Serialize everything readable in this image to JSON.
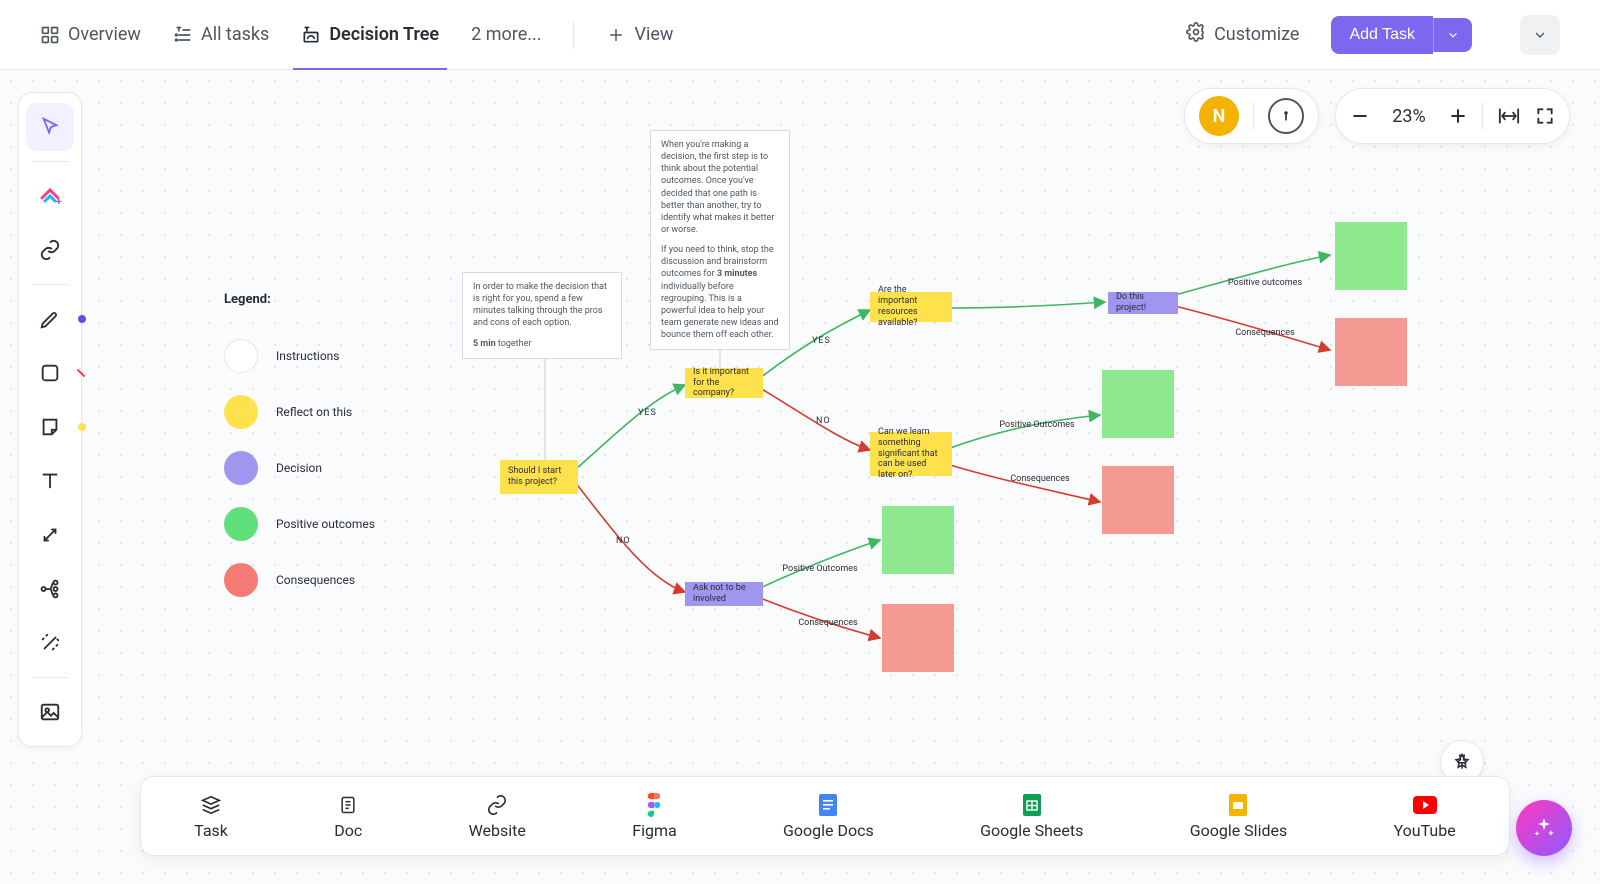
{
  "tabs": {
    "overview": "Overview",
    "all_tasks": "All tasks",
    "decision_tree": "Decision Tree",
    "more": "2 more...",
    "view": "View"
  },
  "top_actions": {
    "customize": "Customize",
    "add_task": "Add Task"
  },
  "avatar_initial": "N",
  "zoom_label": "23%",
  "legend": {
    "title": "Legend:",
    "items": [
      {
        "label": "Instructions",
        "color": "#ffffff",
        "border": "#e8e8ec"
      },
      {
        "label": "Reflect on this",
        "color": "#ffe14b"
      },
      {
        "label": "Decision",
        "color": "#a095ef"
      },
      {
        "label": "Positive outcomes",
        "color": "#60e07a"
      },
      {
        "label": "Consequences",
        "color": "#f57a73"
      }
    ]
  },
  "instructions": {
    "card1_line1": "In order to make the decision that is right for you, spend a few minutes talking through the pros and cons of each option.",
    "card1_line2a": "5 min",
    "card1_line2b": " together",
    "card2_p1": "When you're making a decision, the first step is to think about the potential outcomes. Once you've decided that one path is better than another, try to identify what makes it better or worse.",
    "card2_p2a": "If you need to think, stop the discussion and brainstorm outcomes for ",
    "card2_p2b": "3 minutes",
    "card2_p2c": " individually before regrouping. This is a powerful idea to help your team generate new ideas and bounce them off each other."
  },
  "nodes": {
    "start": "Should I start this project?",
    "important": "Is it important for the company?",
    "ask_not": "Ask not to be involved",
    "resources": "Are the important resources available?",
    "learn": "Can we learn something significant that can be used later on?",
    "do_project": "Do this project!"
  },
  "edge_labels": {
    "yes_vertical_1": "YES",
    "no_vertical_1": "NO",
    "yes_vertical_2": "YES",
    "no_vertical_2": "NO",
    "positive_outcomes": "Positive Outcomes",
    "consequences": "Consequences",
    "positive_outcomes_top": "Positive outcomes",
    "consequences_top": "Consequences"
  },
  "bottom_cards": [
    {
      "key": "task",
      "label": "Task"
    },
    {
      "key": "doc",
      "label": "Doc"
    },
    {
      "key": "website",
      "label": "Website"
    },
    {
      "key": "figma",
      "label": "Figma"
    },
    {
      "key": "gdocs",
      "label": "Google Docs"
    },
    {
      "key": "gsheets",
      "label": "Google Sheets"
    },
    {
      "key": "gslides",
      "label": "Google Slides"
    },
    {
      "key": "youtube",
      "label": "YouTube"
    }
  ],
  "colors": {
    "yellow": "#ffe14b",
    "purple": "#a095ef",
    "green": "#8ee88e",
    "red": "#f59a93",
    "accent": "#7b68ee"
  }
}
